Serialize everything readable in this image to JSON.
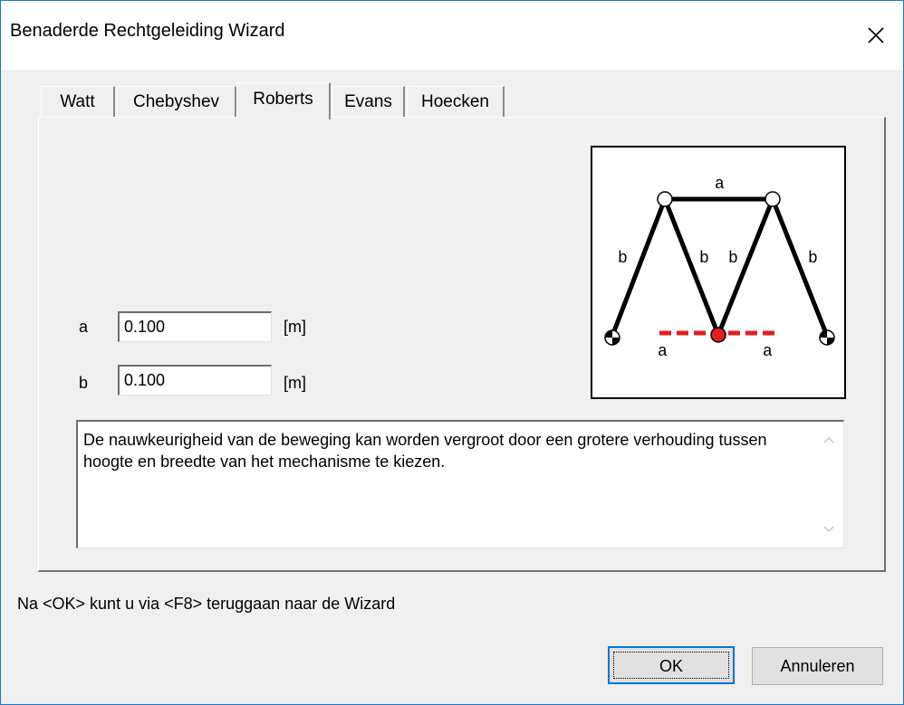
{
  "window": {
    "title": "Benaderde Rechtgeleiding Wizard"
  },
  "tabs": [
    {
      "label": "Watt"
    },
    {
      "label": "Chebyshev"
    },
    {
      "label": "Roberts",
      "active": true
    },
    {
      "label": "Evans"
    },
    {
      "label": "Hoecken"
    }
  ],
  "params": {
    "a": {
      "label": "a",
      "value": "0.100",
      "unit": "[m]"
    },
    "b": {
      "label": "b",
      "value": "0.100",
      "unit": "[m]"
    }
  },
  "diagram": {
    "labels": {
      "top": "a",
      "left": "b",
      "mid_left": "b",
      "mid_right": "b",
      "right": "b",
      "bottom_left": "a",
      "bottom_right": "a"
    },
    "colors": {
      "links": "#000000",
      "coupler_path": "#e02020",
      "coupler_point": "#e02020"
    }
  },
  "description": "De nauwkeurigheid van de beweging kan worden vergroot door een grotere verhouding tussen hoogte en breedte van het mechanisme te kiezen.",
  "hint": "Na <OK> kunt u via <F8> teruggaan naar de Wizard",
  "buttons": {
    "ok": "OK",
    "cancel": "Annuleren"
  }
}
